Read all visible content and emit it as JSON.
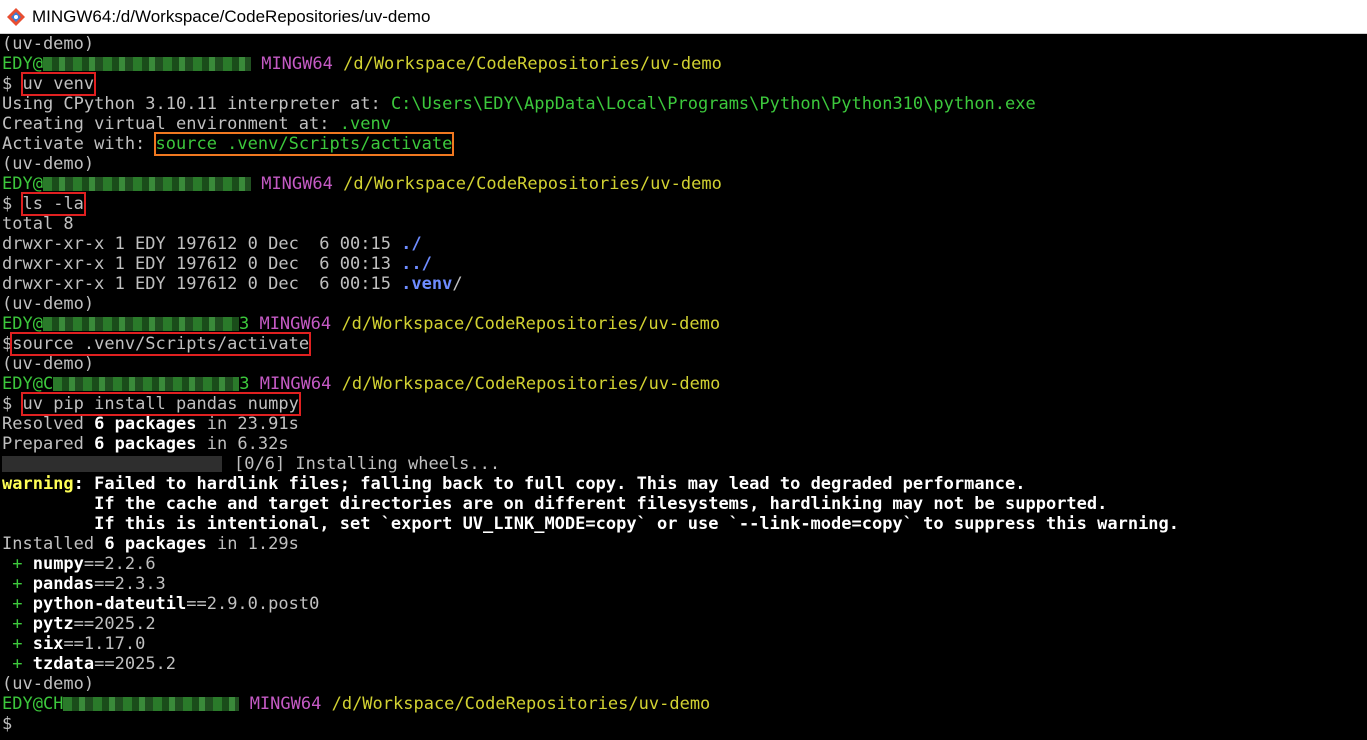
{
  "window": {
    "title": "MINGW64:/d/Workspace/CodeRepositories/uv-demo"
  },
  "prompt": {
    "venv": "(uv-demo)",
    "user": "EDY@",
    "host_suffix_1": "3",
    "host_suffix_2": "3",
    "host_prefix_c": "C",
    "host_prefix_ch": "CH",
    "shell": "MINGW64",
    "path": "/d/Workspace/CodeRepositories/uv-demo",
    "dollar": "$"
  },
  "commands": {
    "c1": "uv venv",
    "c2": "ls -la",
    "c3": "source .venv/Scripts/activate",
    "c4": "uv pip install pandas numpy"
  },
  "venv_output": {
    "using": "Using CPython 3.10.11 interpreter at: ",
    "python_path": "C:\\Users\\EDY\\AppData\\Local\\Programs\\Python\\Python310\\python.exe",
    "creating": "Creating virtual environment at: ",
    "venv_dir": ".venv",
    "activate_label": "Activate with: ",
    "activate_cmd": "source .venv/Scripts/activate"
  },
  "ls_output": {
    "total": "total 8",
    "rows": [
      {
        "meta": "drwxr-xr-x 1 EDY 197612 0 Dec  6 00:15 ",
        "name": "./",
        "slash": ""
      },
      {
        "meta": "drwxr-xr-x 1 EDY 197612 0 Dec  6 00:13 ",
        "name": "../",
        "slash": ""
      },
      {
        "meta": "drwxr-xr-x 1 EDY 197612 0 Dec  6 00:15 ",
        "name": ".venv",
        "slash": "/"
      }
    ]
  },
  "install_output": {
    "resolved_pre": "Resolved ",
    "resolved_bold": "6 packages",
    "resolved_post": " in 23.91s",
    "prepared_pre": "Prepared ",
    "prepared_bold": "6 packages",
    "prepared_post": " in 6.32s",
    "progress": "[0/6] Installing wheels...",
    "warning_label": "warning",
    "warning_1": ": Failed to hardlink files; falling back to full copy. This may lead to degraded performance.",
    "warning_2": "         If the cache and target directories are on different filesystems, hardlinking may not be supported.",
    "warning_3": "         If this is intentional, set `export UV_LINK_MODE=copy` or use `--link-mode=copy` to suppress this warning.",
    "installed_pre": "Installed ",
    "installed_bold": "6 packages",
    "installed_post": " in 1.29s",
    "packages": [
      {
        "name": "numpy",
        "version": "==2.2.6"
      },
      {
        "name": "pandas",
        "version": "==2.3.3"
      },
      {
        "name": "python-dateutil",
        "version": "==2.9.0.post0"
      },
      {
        "name": "pytz",
        "version": "==2025.2"
      },
      {
        "name": "six",
        "version": "==1.17.0"
      },
      {
        "name": "tzdata",
        "version": "==2025.2"
      }
    ],
    "plus": " + "
  },
  "colors": {
    "green": "#3cc83c",
    "magenta": "#c45ac4",
    "yellow": "#d2d232",
    "blue": "#6e8cff",
    "highlight_red": "#e02020",
    "highlight_orange": "#f07820"
  }
}
